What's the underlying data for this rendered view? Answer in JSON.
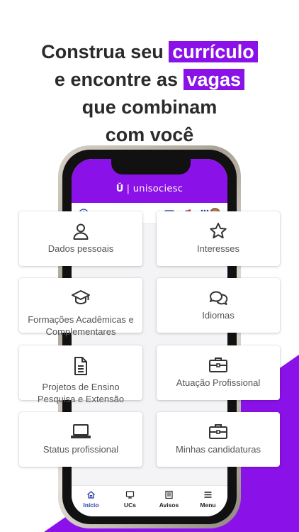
{
  "headline": {
    "line1_prefix": "Construa seu",
    "line1_highlight": "currículo",
    "line2_prefix": "e encontre as",
    "line2_highlight": "vagas",
    "line3": "que combinam",
    "line4": "com você"
  },
  "colors": {
    "brand": "#8a12e8",
    "text": "#2a2a2a",
    "active_tab": "#2a3ea8"
  },
  "app": {
    "logo_mark": "Ŭ",
    "logo_text": "| unisociesc"
  },
  "toolbar_icons": [
    "accessibility-icon",
    "id-card-icon",
    "bell-icon",
    "apps-grid-icon"
  ],
  "cards": [
    {
      "label": "Dados pessoais",
      "icon": "user-icon"
    },
    {
      "label": "Interesses",
      "icon": "star-icon"
    },
    {
      "label": "Formações Acadêmicas e Complementares",
      "icon": "graduation-cap-icon"
    },
    {
      "label": "Idiomas",
      "icon": "chat-bubbles-icon"
    },
    {
      "label": "Projetos de Ensino Pesquisa e Extensão",
      "icon": "document-icon"
    },
    {
      "label": "Atuação Profissional",
      "icon": "briefcase-icon"
    },
    {
      "label": "Status profissional",
      "icon": "laptop-icon"
    },
    {
      "label": "Minhas candidaturas",
      "icon": "briefcase-icon"
    }
  ],
  "tabs": [
    {
      "label": "Início",
      "icon": "home-icon",
      "active": true
    },
    {
      "label": "UCs",
      "icon": "screen-icon",
      "active": false
    },
    {
      "label": "Avisos",
      "icon": "newspaper-icon",
      "active": false
    },
    {
      "label": "Menu",
      "icon": "hamburger-icon",
      "active": false
    }
  ]
}
